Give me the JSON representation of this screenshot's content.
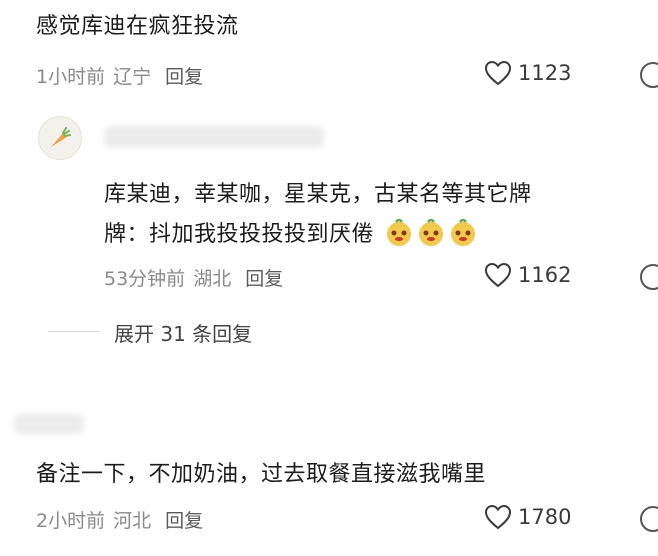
{
  "comments": [
    {
      "text": "感觉库迪在疯狂投流",
      "time": "1小时前",
      "location": "辽宁",
      "reply_label": "回复",
      "likes": "1123"
    },
    {
      "text_line1": "库某迪，幸某咖，星某克，古某名等其它牌",
      "text_line2": "牌：抖加我投投投投到厌倦",
      "emoji_count": 3,
      "time": "53分钟前",
      "location": "湖北",
      "reply_label": "回复",
      "likes": "1162",
      "expand_label": "展开 31 条回复"
    },
    {
      "text": "备注一下，不加奶油，过去取餐直接滋我嘴里",
      "time": "2小时前",
      "location": "河北",
      "reply_label": "回复",
      "likes": "1780"
    }
  ],
  "colors": {
    "text": "#1c1c1c",
    "meta": "#8a8a8a",
    "emoji_face": "#f2c94c"
  },
  "icons": [
    "heart-outline-icon",
    "emoji-face-icon",
    "carrot-avatar-icon"
  ]
}
